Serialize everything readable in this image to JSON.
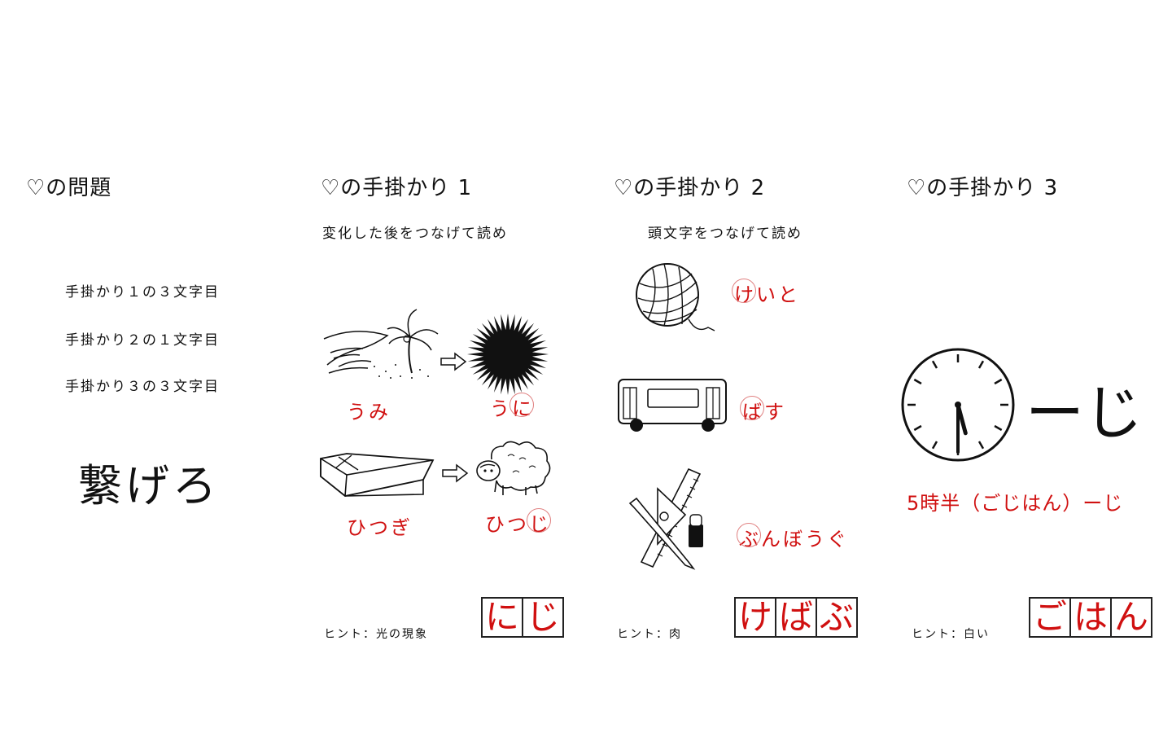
{
  "problem": {
    "title": "♡の問題",
    "lines": [
      "手掛かり１の３文字目",
      "手掛かり２の１文字目",
      "手掛かり３の３文字目"
    ],
    "instruction": "繋げろ"
  },
  "clue1": {
    "title": "♡の手掛かり 1",
    "subtitle": "変化した後をつなげて読め",
    "pairs": [
      {
        "before": "うみ",
        "after_prefix": "う",
        "after_mark": "に"
      },
      {
        "before": "ひつぎ",
        "after_prefix": "ひつ",
        "after_mark": "じ"
      }
    ],
    "hint": "ヒント：光の現象",
    "answer": [
      "に",
      "じ"
    ]
  },
  "clue2": {
    "title": "♡の手掛かり 2",
    "subtitle": "頭文字をつなげて読め",
    "items": [
      {
        "mark": "け",
        "rest": "いと",
        "icon": "yarn-ball-icon"
      },
      {
        "mark": "ば",
        "rest": "す",
        "icon": "bus-icon"
      },
      {
        "mark": "ぶ",
        "rest": "んぼうぐ",
        "icon": "stationery-icon"
      }
    ],
    "hint": "ヒント：肉",
    "answer": [
      "け",
      "ば",
      "ぶ"
    ]
  },
  "clue3": {
    "title": "♡の手掛かり 3",
    "puzzle_suffix": "ーじ",
    "explanation": "5時半（ごじはん）ーじ",
    "hint": "ヒント：白い",
    "answer": [
      "ご",
      "は",
      "ん"
    ]
  },
  "colors": {
    "accent": "#d01010",
    "ink": "#111111"
  }
}
